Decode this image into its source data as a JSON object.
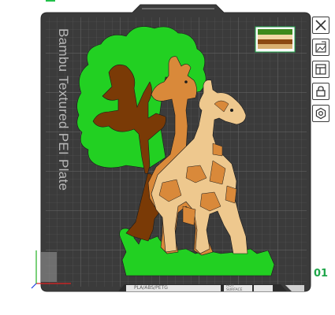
{
  "plate": {
    "title": "Bambu Textured PEI Plate",
    "number": "01",
    "filament_tag": "PLA/ABS/PETG",
    "surface_tag": "HOT SURFACE"
  },
  "toolbar": [
    {
      "name": "close-icon"
    },
    {
      "name": "edit-plate-icon"
    },
    {
      "name": "arrange-icon"
    },
    {
      "name": "lock-icon"
    },
    {
      "name": "settings-icon"
    }
  ],
  "colors": {
    "plate": "#3a3a3a",
    "grid": "#565656",
    "leaves": "#22d022",
    "trunk": "#7a3a06",
    "giraffe_dark": "#d9893a",
    "giraffe_light": "#eec88e",
    "accent": "#1fa64a"
  }
}
